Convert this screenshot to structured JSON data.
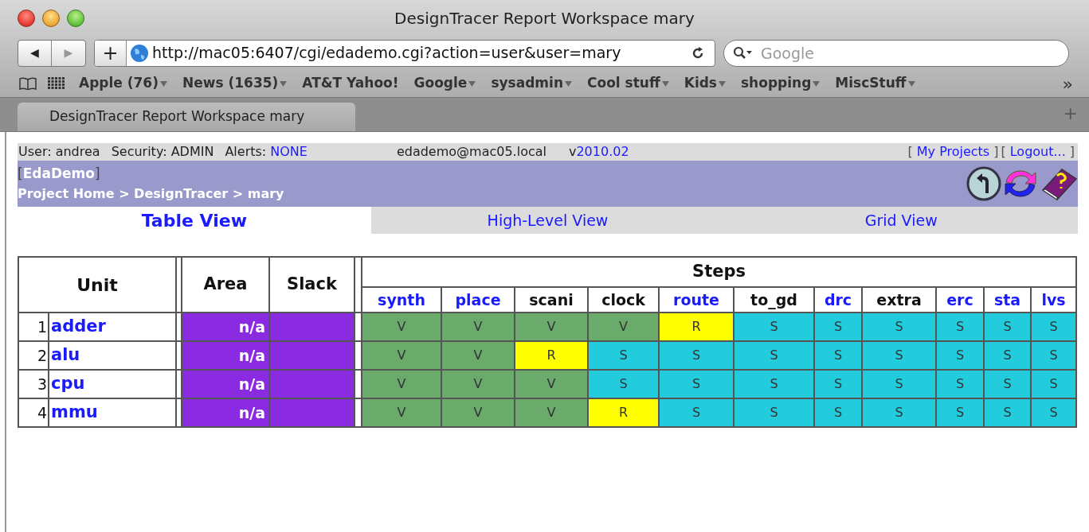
{
  "window": {
    "title": "DesignTracer Report Workspace mary"
  },
  "toolbar": {
    "back": "◀",
    "forward": "▶",
    "add": "+",
    "url": "http://mac05:6407/cgi/edademo.cgi?action=user&user=mary",
    "search_placeholder": "Google"
  },
  "bookmarks": [
    {
      "label": "Apple (76)",
      "menu": true
    },
    {
      "label": "News (1635)",
      "menu": true
    },
    {
      "label": "AT&T Yahoo!",
      "menu": false
    },
    {
      "label": "Google",
      "menu": true
    },
    {
      "label": "sysadmin",
      "menu": true
    },
    {
      "label": "Cool stuff",
      "menu": true
    },
    {
      "label": "Kids",
      "menu": true
    },
    {
      "label": "shopping",
      "menu": true
    },
    {
      "label": "MiscStuff",
      "menu": true
    }
  ],
  "bookmarks_more": "»",
  "browser_tabs": [
    {
      "label": "DesignTracer Report Workspace mary",
      "selected": true
    }
  ],
  "new_tab": "+",
  "info_bar": {
    "user": "User: andrea",
    "security": "Security: ADMIN",
    "alerts_label": "Alerts:",
    "alerts_value": "NONE",
    "host": "edademo@mac05.local",
    "version_prefix": "v",
    "version": "2010.02",
    "links": [
      {
        "open": "[",
        "label": "My Projects",
        "close": "]"
      },
      {
        "open": "[",
        "label": "Logout...",
        "close": "]"
      }
    ]
  },
  "project": {
    "open": "[",
    "name": "EdaDemo",
    "close": "]",
    "breadcrumb": "Project Home > DesignTracer > mary"
  },
  "view_tabs": [
    {
      "label": "Table View",
      "selected": true
    },
    {
      "label": "High-Level View",
      "selected": false
    },
    {
      "label": "Grid View",
      "selected": false
    }
  ],
  "table": {
    "columns": {
      "unit": "Unit",
      "area": "Area",
      "slack": "Slack",
      "steps": "Steps"
    },
    "steps": [
      {
        "label": "synth",
        "link": true
      },
      {
        "label": "place",
        "link": true
      },
      {
        "label": "scani",
        "link": false
      },
      {
        "label": "clock",
        "link": false
      },
      {
        "label": "route",
        "link": true
      },
      {
        "label": "to_gd",
        "link": false
      },
      {
        "label": "drc",
        "link": true
      },
      {
        "label": "extra",
        "link": false
      },
      {
        "label": "erc",
        "link": true
      },
      {
        "label": "sta",
        "link": true
      },
      {
        "label": "lvs",
        "link": true
      }
    ],
    "rows": [
      {
        "index": "1",
        "unit": "adder",
        "area": "n/a",
        "cells": [
          {
            "text": "V",
            "kind": "done"
          },
          {
            "text": "V",
            "kind": "done"
          },
          {
            "text": "V",
            "kind": "done"
          },
          {
            "text": "V",
            "kind": "done"
          },
          {
            "text": "R",
            "kind": "running"
          },
          {
            "text": "S",
            "kind": "scheduled"
          },
          {
            "text": "S",
            "kind": "scheduled"
          },
          {
            "text": "S",
            "kind": "scheduled"
          },
          {
            "text": "S",
            "kind": "scheduled"
          },
          {
            "text": "S",
            "kind": "scheduled"
          },
          {
            "text": "S",
            "kind": "scheduled"
          }
        ]
      },
      {
        "index": "2",
        "unit": "alu",
        "area": "n/a",
        "cells": [
          {
            "text": "V",
            "kind": "done"
          },
          {
            "text": "V",
            "kind": "done"
          },
          {
            "text": "R",
            "kind": "running"
          },
          {
            "text": "S",
            "kind": "scheduled"
          },
          {
            "text": "S",
            "kind": "scheduled"
          },
          {
            "text": "S",
            "kind": "scheduled"
          },
          {
            "text": "S",
            "kind": "scheduled"
          },
          {
            "text": "S",
            "kind": "scheduled"
          },
          {
            "text": "S",
            "kind": "scheduled"
          },
          {
            "text": "S",
            "kind": "scheduled"
          },
          {
            "text": "S",
            "kind": "scheduled"
          }
        ]
      },
      {
        "index": "3",
        "unit": "cpu",
        "area": "n/a",
        "cells": [
          {
            "text": "V",
            "kind": "done"
          },
          {
            "text": "V",
            "kind": "done"
          },
          {
            "text": "V",
            "kind": "done"
          },
          {
            "text": "S",
            "kind": "scheduled"
          },
          {
            "text": "S",
            "kind": "scheduled"
          },
          {
            "text": "S",
            "kind": "scheduled"
          },
          {
            "text": "S",
            "kind": "scheduled"
          },
          {
            "text": "S",
            "kind": "scheduled"
          },
          {
            "text": "S",
            "kind": "scheduled"
          },
          {
            "text": "S",
            "kind": "scheduled"
          },
          {
            "text": "S",
            "kind": "scheduled"
          }
        ]
      },
      {
        "index": "4",
        "unit": "mmu",
        "area": "n/a",
        "cells": [
          {
            "text": "V",
            "kind": "done"
          },
          {
            "text": "V",
            "kind": "done"
          },
          {
            "text": "V",
            "kind": "done"
          },
          {
            "text": "R",
            "kind": "running"
          },
          {
            "text": "S",
            "kind": "scheduled"
          },
          {
            "text": "S",
            "kind": "scheduled"
          },
          {
            "text": "S",
            "kind": "scheduled"
          },
          {
            "text": "S",
            "kind": "scheduled"
          },
          {
            "text": "S",
            "kind": "scheduled"
          },
          {
            "text": "S",
            "kind": "scheduled"
          },
          {
            "text": "S",
            "kind": "scheduled"
          }
        ]
      }
    ]
  }
}
